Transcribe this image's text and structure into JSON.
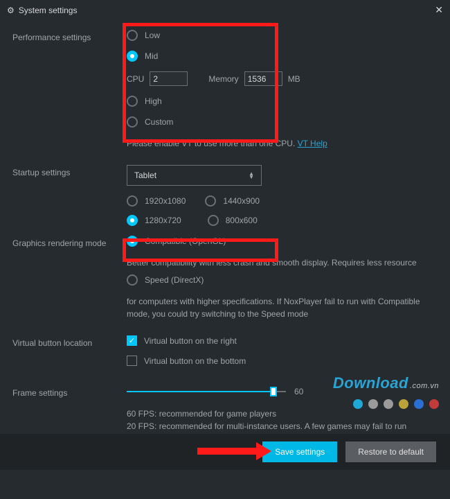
{
  "titlebar": {
    "title": "System settings"
  },
  "performance": {
    "label": "Performance settings",
    "options": {
      "low": "Low",
      "mid": "Mid",
      "high": "High",
      "custom": "Custom"
    },
    "cpu_label": "CPU",
    "cpu_value": "2",
    "mem_label": "Memory",
    "mem_value": "1536",
    "mem_unit": "MB",
    "vt_hint": "Please enable VT to use more than one CPU.",
    "vt_link": "VT Help"
  },
  "startup": {
    "label": "Startup settings",
    "mode": "Tablet",
    "resolutions": [
      "1920x1080",
      "1440x900",
      "1280x720",
      "800x600"
    ],
    "selected_resolution": "1280x720"
  },
  "graphics": {
    "label": "Graphics rendering mode",
    "compatible": "Compatible (OpenGL)",
    "compatible_hint": "Better compatibility with less crash and smooth display. Requires less resource",
    "speed": "Speed (DirectX)",
    "speed_hint": "for computers with higher specifications. If NoxPlayer fail to run with Compatible mode, you could try switching to the Speed mode"
  },
  "vbutton": {
    "label": "Virtual button location",
    "right": "Virtual button on the right",
    "bottom": "Virtual button on the bottom"
  },
  "frame": {
    "label": "Frame settings",
    "value": "60",
    "hint": "60 FPS: recommended for game players\n20 FPS: recommended for multi-instance users. A few games may fail to run properly."
  },
  "buttons": {
    "save": "Save settings",
    "restore": "Restore to default"
  },
  "watermark": {
    "text": "Download",
    "domain": ".com.vn"
  },
  "dots": [
    "#1fa9d6",
    "#9a9a9a",
    "#9a9a9a",
    "#bba23a",
    "#2a6fd4",
    "#c23a3a"
  ]
}
